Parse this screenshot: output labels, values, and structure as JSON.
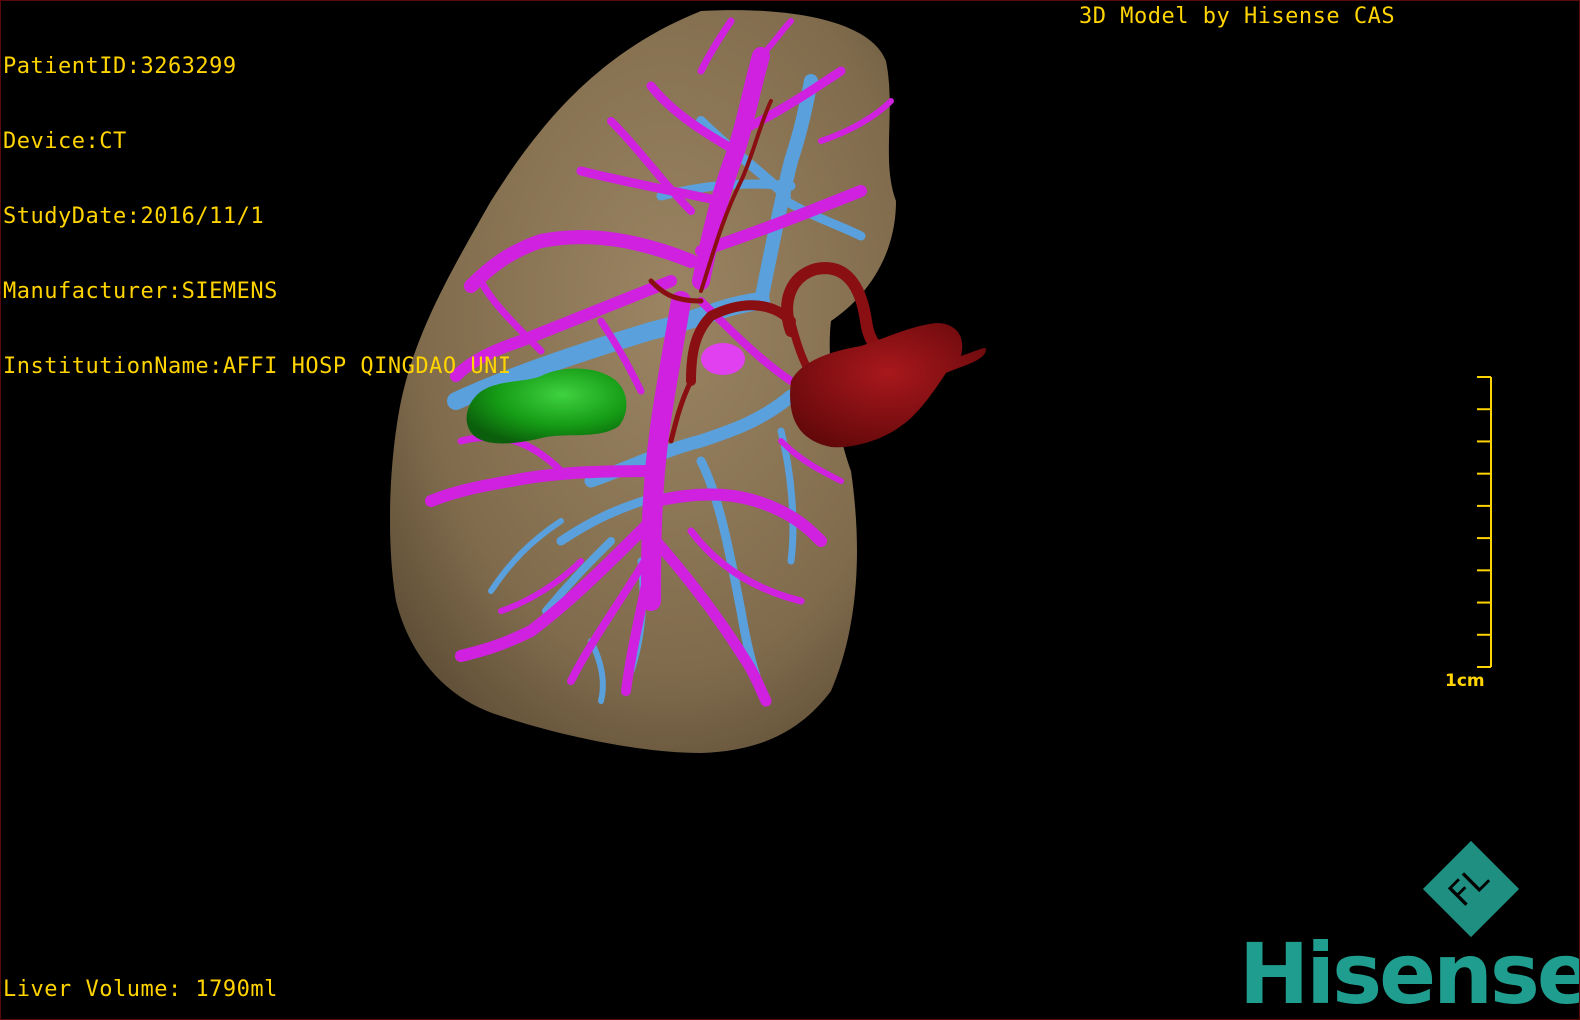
{
  "dicom": {
    "patient_id": "PatientID:3263299",
    "device": "Device:CT",
    "study_date": "StudyDate:2016/11/1",
    "manufacturer": "Manufacturer:SIEMENS",
    "institution": "InstitutionName:AFFI HOSP QINGDAO UNI"
  },
  "credit": "3D Model by Hisense CAS",
  "liver_volume": "Liver Volume: 1790ml",
  "scale": {
    "label": "1cm",
    "ticks": 10
  },
  "brand": {
    "name": "Hisense",
    "mark_letters": "FL"
  },
  "colors": {
    "overlay_text": "#ffd400",
    "liver": "#8a7453",
    "portal_vein": "#d020e0",
    "hepatic_vein": "#5aa0dc",
    "artery": "#8a0f12",
    "lesion": "#1a9a1a",
    "brand": "#1f9e8f"
  },
  "structure_icons": [
    "liver-surface-icon",
    "portal-vein-icon",
    "hepatic-vein-icon",
    "artery-icon",
    "lesion-icon"
  ]
}
